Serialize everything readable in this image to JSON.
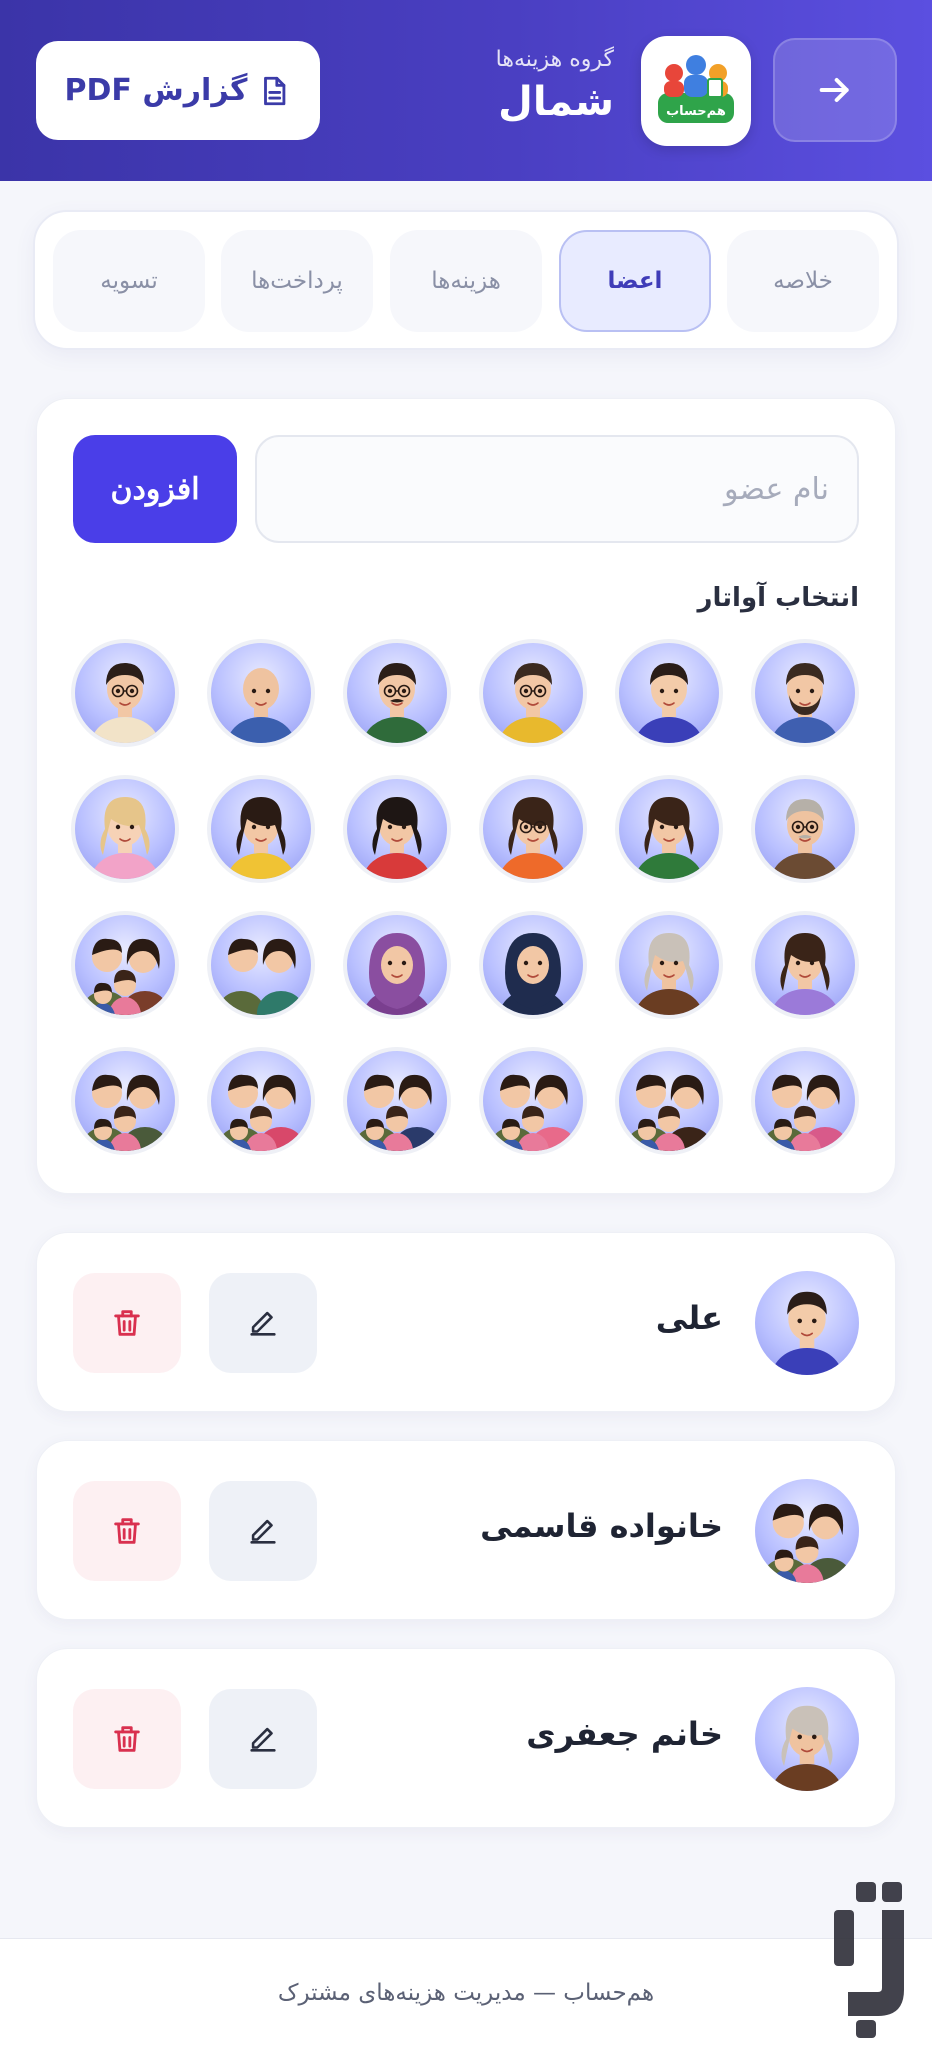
{
  "header": {
    "subtitle": "گروه هزینه‌ها",
    "title": "شمال",
    "pdf_label": "گزارش PDF",
    "logo_text": "هم‌حساب"
  },
  "tabs": [
    {
      "label": "خلاصه",
      "active": false
    },
    {
      "label": "اعضا",
      "active": true
    },
    {
      "label": "هزینه‌ها",
      "active": false
    },
    {
      "label": "پرداخت‌ها",
      "active": false
    },
    {
      "label": "تسویه",
      "active": false
    }
  ],
  "add_member": {
    "input_placeholder": "نام عضو",
    "input_value": "",
    "add_label": "افزودن",
    "avatar_label": "انتخاب آواتار"
  },
  "avatars": [
    {
      "type": "man-beard",
      "shirt": "#3f5fb0",
      "hair": "#3a2a20",
      "skin": "#f2c7a5"
    },
    {
      "type": "young-man",
      "shirt": "#3a3fb8",
      "hair": "#2a1d18",
      "skin": "#f3cba9"
    },
    {
      "type": "man-glasses",
      "shirt": "#e8b92d",
      "hair": "#3b2a20",
      "skin": "#f2c7a5"
    },
    {
      "type": "man-glasses-mustache",
      "shirt": "#2f6b3a",
      "hair": "#2b1e18",
      "skin": "#f2c7a5"
    },
    {
      "type": "bald-man",
      "shirt": "#3b5fae",
      "hair": "none",
      "skin": "#efc3a0"
    },
    {
      "type": "man-glasses-round",
      "shirt": "#f2e3c8",
      "hair": "#2b1e18",
      "skin": "#f2c7a5"
    },
    {
      "type": "old-man-glasses",
      "shirt": "#6b4b33",
      "hair": "#b6b0a8",
      "skin": "#efc3a0"
    },
    {
      "type": "woman-curly",
      "shirt": "#2f7a3a",
      "hair": "#3a2418",
      "skin": "#f2c7a5"
    },
    {
      "type": "woman-glasses-bun",
      "shirt": "#ee6a2a",
      "hair": "#3a2418",
      "skin": "#f2c7a5"
    },
    {
      "type": "woman-bob",
      "shirt": "#d83a3a",
      "hair": "#1e1614",
      "skin": "#f2c7a5"
    },
    {
      "type": "woman-curly-yellow",
      "shirt": "#f0c334",
      "hair": "#2a1b14",
      "skin": "#f2c7a5"
    },
    {
      "type": "woman-blonde",
      "shirt": "#f2a3c8",
      "hair": "#e6c58a",
      "skin": "#f6d2b6"
    },
    {
      "type": "woman-wavy",
      "shirt": "#9b7ad9",
      "hair": "#3a2418",
      "skin": "#f2c7a5"
    },
    {
      "type": "grandma",
      "shirt": "#6a3d22",
      "hair": "#c9c1b8",
      "skin": "#efc3a0"
    },
    {
      "type": "woman-hijab-dark",
      "shirt": "#1f2c4e",
      "hair": "#1f2c4e",
      "skin": "#f2c7a5"
    },
    {
      "type": "woman-hijab-purple",
      "shirt": "#7a3f8f",
      "hair": "#8a4ea0",
      "skin": "#f2c7a5"
    },
    {
      "type": "couple",
      "shirt": "#2f7a6a",
      "hair": "#2a1b14",
      "skin": "#f2c7a5"
    },
    {
      "type": "family",
      "shirt": "#7a3d2a",
      "hair": "#2a1b14",
      "skin": "#f2c7a5"
    },
    {
      "type": "family",
      "shirt": "#d85a8a",
      "hair": "#2a1b14",
      "skin": "#f2c7a5"
    },
    {
      "type": "family",
      "shirt": "#3a2418",
      "hair": "#2a1b14",
      "skin": "#f2c7a5"
    },
    {
      "type": "family",
      "shirt": "#e86a8a",
      "hair": "#2a1b14",
      "skin": "#f2c7a5"
    },
    {
      "type": "family",
      "shirt": "#2a3a6a",
      "hair": "#2a1b14",
      "skin": "#f2c7a5"
    },
    {
      "type": "family",
      "shirt": "#d8486a",
      "hair": "#2a1b14",
      "skin": "#f2c7a5"
    },
    {
      "type": "family",
      "shirt": "#4a5a3a",
      "hair": "#2a1b14",
      "skin": "#f2c7a5"
    }
  ],
  "members": [
    {
      "name": "علی",
      "avatar_type": "young-man",
      "shirt": "#3a3fb8",
      "hair": "#2a1d18",
      "skin": "#f3cba9"
    },
    {
      "name": "خانواده قاسمی",
      "avatar_type": "family",
      "shirt": "#4a5a3a",
      "hair": "#2a1b14",
      "skin": "#f2c7a5"
    },
    {
      "name": "خانم جعفری",
      "avatar_type": "grandma",
      "shirt": "#6a3d22",
      "hair": "#c9c1b8",
      "skin": "#efc3a0"
    }
  ],
  "footer": {
    "text": "هم‌حساب — مدیریت هزینه‌های مشترک"
  },
  "colors": {
    "header_start": "#3b34a8",
    "header_end": "#5b4fe0",
    "primary": "#4a3ee8",
    "danger": "#d9304f"
  },
  "icons": {
    "back": "arrow-right-icon",
    "pdf": "document-icon",
    "edit": "pencil-icon",
    "delete": "trash-icon"
  }
}
